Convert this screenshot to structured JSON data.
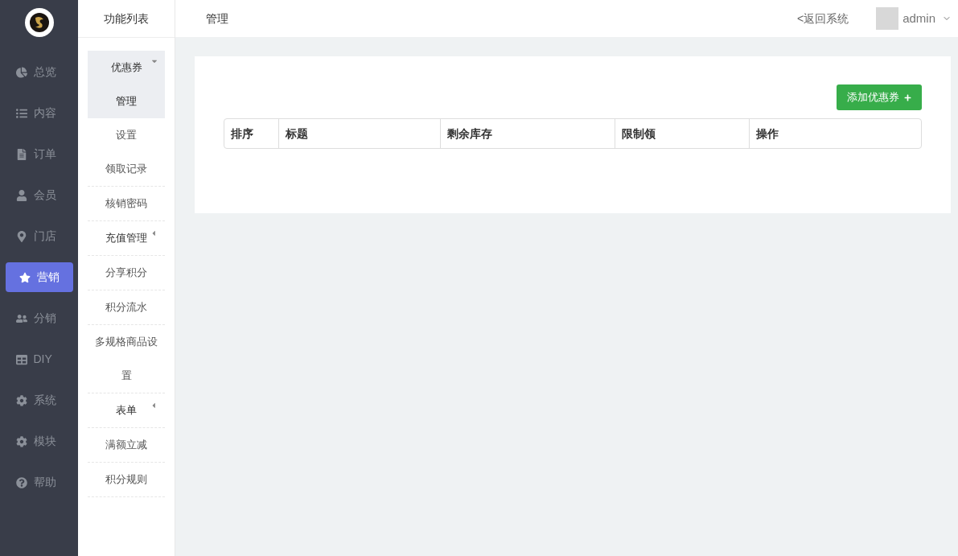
{
  "nav": [
    {
      "label": "总览",
      "selected": false
    },
    {
      "label": "内容",
      "selected": false
    },
    {
      "label": "订单",
      "selected": false
    },
    {
      "label": "会员",
      "selected": false
    },
    {
      "label": "门店",
      "selected": false
    },
    {
      "label": "营销",
      "selected": true
    },
    {
      "label": "分销",
      "selected": false
    },
    {
      "label": "DIY",
      "selected": false
    },
    {
      "label": "系统",
      "selected": false
    },
    {
      "label": "模块",
      "selected": false
    },
    {
      "label": "帮助",
      "selected": false
    }
  ],
  "submenu": {
    "title": "功能列表",
    "items": [
      {
        "kind": "group",
        "label": "优惠券",
        "expanded": true,
        "children": [
          {
            "label": "管理",
            "selected": true
          },
          {
            "label": "设置",
            "selected": false
          },
          {
            "label": "领取记录",
            "selected": false
          }
        ]
      },
      {
        "kind": "link",
        "label": "核销密码",
        "selected": false
      },
      {
        "kind": "group",
        "label": "充值管理",
        "expanded": false
      },
      {
        "kind": "link",
        "label": "分享积分",
        "selected": false
      },
      {
        "kind": "link",
        "label": "积分流水",
        "selected": false
      },
      {
        "kind": "link",
        "label": "多规格商品设置",
        "selected": false
      },
      {
        "kind": "group",
        "label": "表单",
        "expanded": false
      },
      {
        "kind": "link",
        "label": "满额立减",
        "selected": false
      },
      {
        "kind": "link",
        "label": "积分规则",
        "selected": false
      }
    ]
  },
  "header": {
    "title": "管理",
    "back_link": "<返回系统",
    "user": "admin"
  },
  "panel": {
    "add_button": "添加优惠券",
    "table": {
      "columns": [
        "排序",
        "标题",
        "剩余库存",
        "限制领",
        "操作"
      ]
    }
  }
}
